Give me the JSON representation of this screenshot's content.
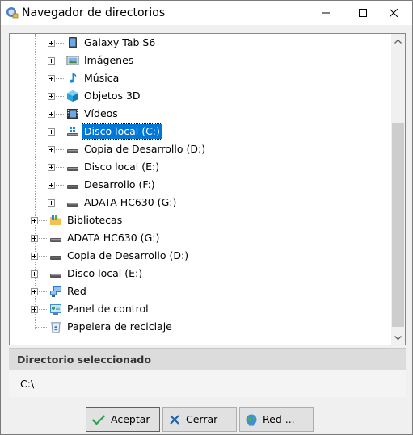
{
  "window": {
    "title": "Navegador de directorios"
  },
  "tree": {
    "items": [
      {
        "label": "Galaxy Tab S6",
        "icon": "tablet-icon",
        "expandable": true
      },
      {
        "label": "Imágenes",
        "icon": "pictures-icon",
        "expandable": true
      },
      {
        "label": "Música",
        "icon": "music-icon",
        "expandable": true
      },
      {
        "label": "Objetos 3D",
        "icon": "3d-objects-icon",
        "expandable": true
      },
      {
        "label": "Vídeos",
        "icon": "videos-icon",
        "expandable": true
      },
      {
        "label": "Disco local (C:)",
        "icon": "drive-windows-icon",
        "expandable": true,
        "selected": true
      },
      {
        "label": "Copia de Desarrollo (D:)",
        "icon": "drive-icon",
        "expandable": true
      },
      {
        "label": "Disco local (E:)",
        "icon": "drive-icon",
        "expandable": true
      },
      {
        "label": "Desarrollo (F:)",
        "icon": "drive-icon",
        "expandable": true
      },
      {
        "label": "ADATA HC630 (G:)",
        "icon": "drive-icon",
        "expandable": true
      },
      {
        "label": "Bibliotecas",
        "icon": "libraries-icon",
        "expandable": true
      },
      {
        "label": "ADATA HC630 (G:)",
        "icon": "drive-icon",
        "expandable": true
      },
      {
        "label": "Copia de Desarrollo (D:)",
        "icon": "drive-icon",
        "expandable": true
      },
      {
        "label": "Disco local (E:)",
        "icon": "drive-icon",
        "expandable": true
      },
      {
        "label": "Red",
        "icon": "network-icon",
        "expandable": true
      },
      {
        "label": "Panel de control",
        "icon": "control-panel-icon",
        "expandable": true
      },
      {
        "label": "Papelera de reciclaje",
        "icon": "recycle-bin-icon",
        "expandable": false
      }
    ]
  },
  "selected_section": {
    "title": "Directorio seleccionado",
    "path": "C:\\"
  },
  "buttons": {
    "accept_label": "Aceptar",
    "close_label": "Cerrar",
    "network_label": "Red ..."
  },
  "colors": {
    "selection": "#0078d7",
    "accent_green": "#2e9e4f",
    "close_blue": "#1f5fa8"
  }
}
